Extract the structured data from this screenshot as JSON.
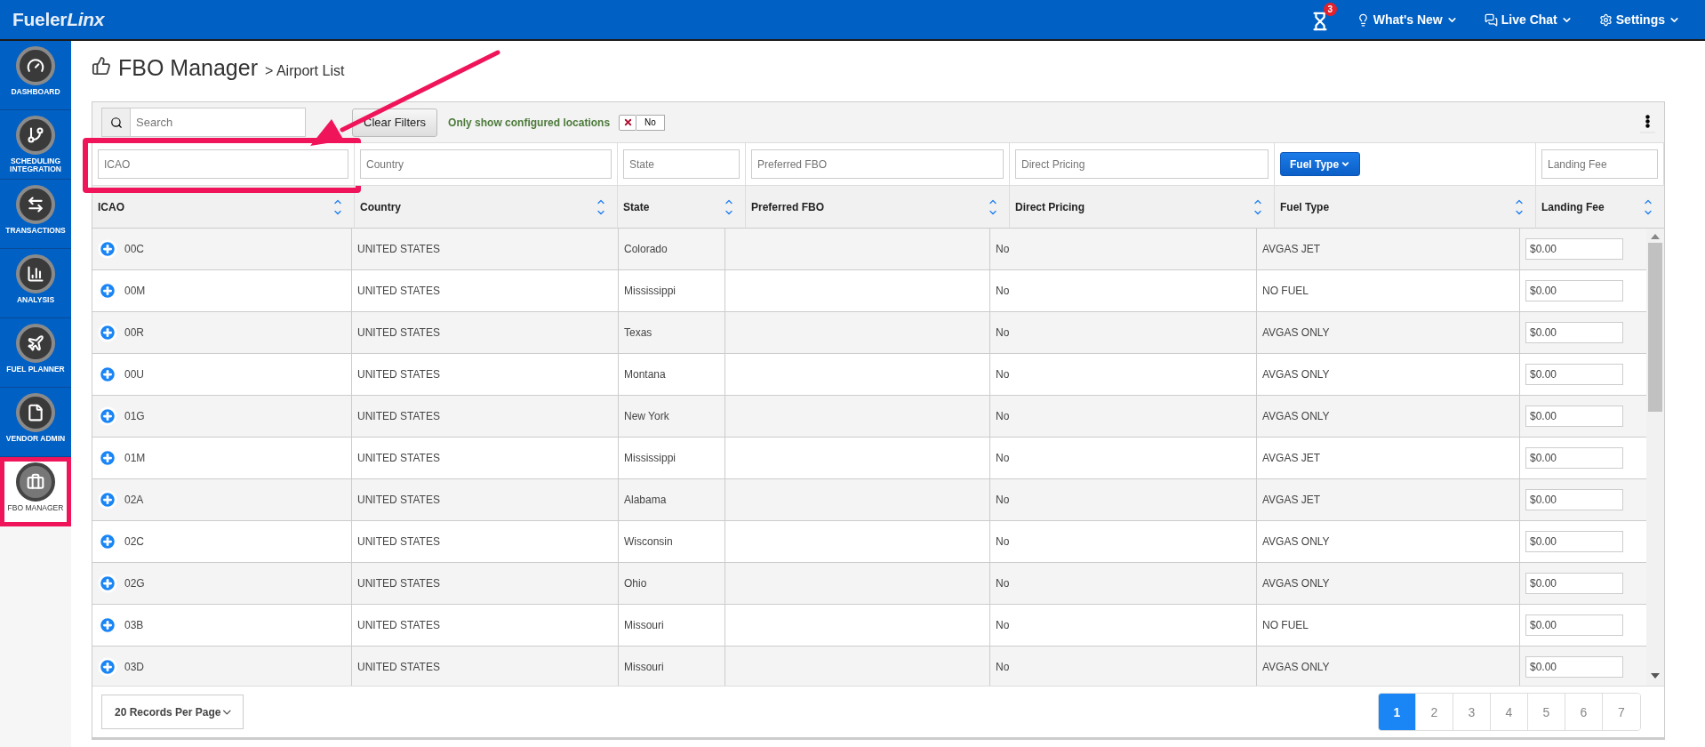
{
  "topbar": {
    "logo_main": "Fueler",
    "logo_accent": "Linx",
    "notification_count": "3",
    "menus": [
      "What's New",
      "Live Chat",
      "Settings"
    ]
  },
  "sidebar": {
    "items": [
      {
        "label": "DASHBOARD",
        "selected": false
      },
      {
        "label": "SCHEDULING INTEGRATION",
        "selected": false
      },
      {
        "label": "TRANSACTIONS",
        "selected": false
      },
      {
        "label": "ANALYSIS",
        "selected": false
      },
      {
        "label": "FUEL PLANNER",
        "selected": false
      },
      {
        "label": "VENDOR ADMIN",
        "selected": false
      },
      {
        "label": "FBO MANAGER",
        "selected": true
      }
    ]
  },
  "page": {
    "title": "FBO Manager",
    "breadcrumb": "> Airport List"
  },
  "toolbar": {
    "search": {
      "placeholder": "Search"
    },
    "clear_button": "Clear Filters",
    "configured_label": "Only show configured locations",
    "configured_toggle": {
      "on": false,
      "label": "No"
    }
  },
  "table": {
    "filters": [
      {
        "kind": "input",
        "placeholder": "ICAO"
      },
      {
        "kind": "input",
        "placeholder": "Country"
      },
      {
        "kind": "input",
        "placeholder": "State"
      },
      {
        "kind": "input",
        "placeholder": "Preferred FBO"
      },
      {
        "kind": "input",
        "placeholder": "Direct Pricing"
      },
      {
        "kind": "dropdown",
        "label": "Fuel Type"
      },
      {
        "kind": "input",
        "placeholder": "Landing Fee"
      }
    ],
    "columns": [
      "ICAO",
      "Country",
      "State",
      "Preferred FBO",
      "Direct Pricing",
      "Fuel Type",
      "Landing Fee"
    ],
    "rows": [
      {
        "icao": "00C",
        "country": "UNITED STATES",
        "state": "Colorado",
        "preferred_fbo": "",
        "direct_pricing": "No",
        "fuel_type": "AVGAS JET",
        "landing_fee": "$0.00"
      },
      {
        "icao": "00M",
        "country": "UNITED STATES",
        "state": "Mississippi",
        "preferred_fbo": "",
        "direct_pricing": "No",
        "fuel_type": "NO FUEL",
        "landing_fee": "$0.00"
      },
      {
        "icao": "00R",
        "country": "UNITED STATES",
        "state": "Texas",
        "preferred_fbo": "",
        "direct_pricing": "No",
        "fuel_type": "AVGAS ONLY",
        "landing_fee": "$0.00"
      },
      {
        "icao": "00U",
        "country": "UNITED STATES",
        "state": "Montana",
        "preferred_fbo": "",
        "direct_pricing": "No",
        "fuel_type": "AVGAS ONLY",
        "landing_fee": "$0.00"
      },
      {
        "icao": "01G",
        "country": "UNITED STATES",
        "state": "New York",
        "preferred_fbo": "",
        "direct_pricing": "No",
        "fuel_type": "AVGAS ONLY",
        "landing_fee": "$0.00"
      },
      {
        "icao": "01M",
        "country": "UNITED STATES",
        "state": "Mississippi",
        "preferred_fbo": "",
        "direct_pricing": "No",
        "fuel_type": "AVGAS JET",
        "landing_fee": "$0.00"
      },
      {
        "icao": "02A",
        "country": "UNITED STATES",
        "state": "Alabama",
        "preferred_fbo": "",
        "direct_pricing": "No",
        "fuel_type": "AVGAS JET",
        "landing_fee": "$0.00"
      },
      {
        "icao": "02C",
        "country": "UNITED STATES",
        "state": "Wisconsin",
        "preferred_fbo": "",
        "direct_pricing": "No",
        "fuel_type": "AVGAS ONLY",
        "landing_fee": "$0.00"
      },
      {
        "icao": "02G",
        "country": "UNITED STATES",
        "state": "Ohio",
        "preferred_fbo": "",
        "direct_pricing": "No",
        "fuel_type": "AVGAS ONLY",
        "landing_fee": "$0.00"
      },
      {
        "icao": "03B",
        "country": "UNITED STATES",
        "state": "Missouri",
        "preferred_fbo": "",
        "direct_pricing": "No",
        "fuel_type": "NO FUEL",
        "landing_fee": "$0.00"
      },
      {
        "icao": "03D",
        "country": "UNITED STATES",
        "state": "Missouri",
        "preferred_fbo": "",
        "direct_pricing": "No",
        "fuel_type": "AVGAS ONLY",
        "landing_fee": "$0.00"
      }
    ]
  },
  "footer": {
    "page_size": "20 Records Per Page",
    "pages": [
      {
        "label": "1",
        "selected": true
      },
      {
        "label": "2",
        "selected": false
      },
      {
        "label": "3",
        "selected": false
      },
      {
        "label": "4",
        "selected": false
      },
      {
        "label": "5",
        "selected": false
      },
      {
        "label": "6",
        "selected": false
      },
      {
        "label": "7",
        "selected": false
      }
    ]
  }
}
